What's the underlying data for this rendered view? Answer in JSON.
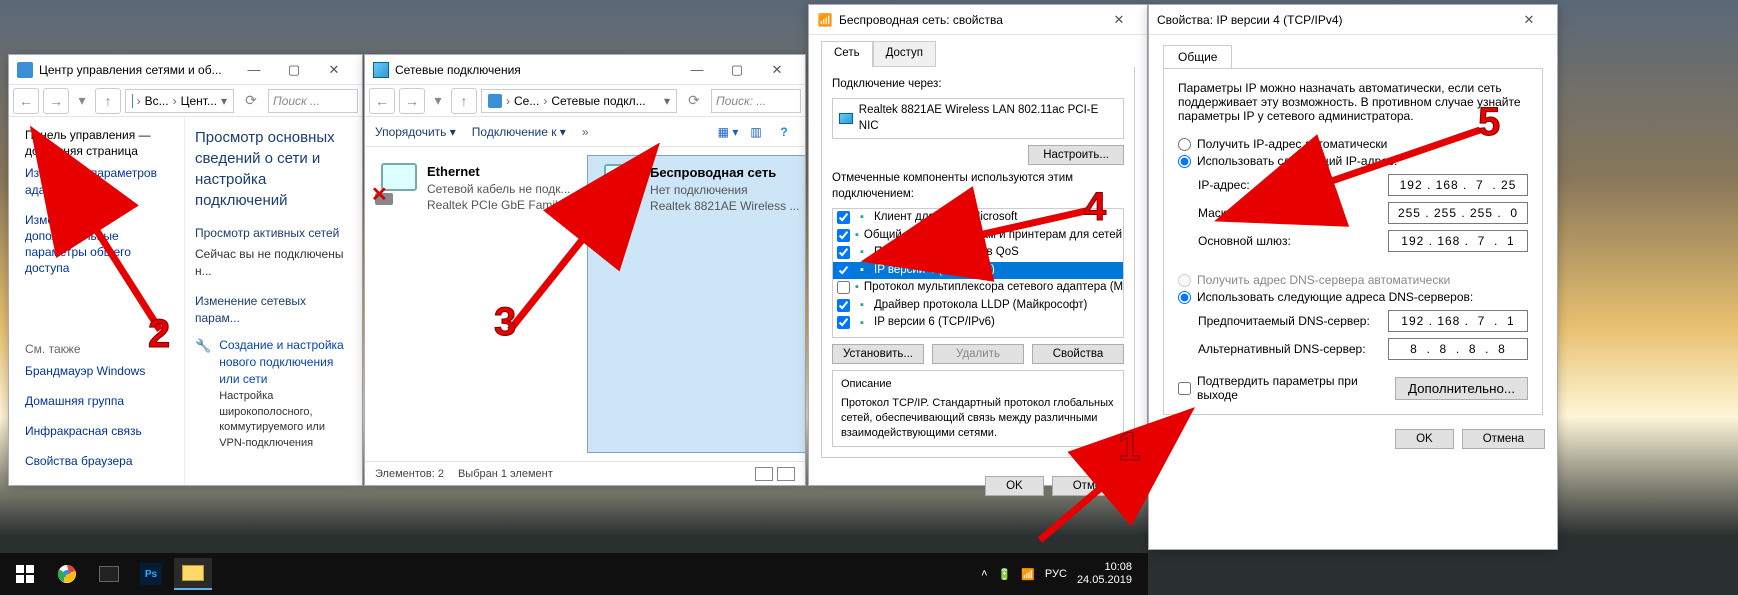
{
  "w1": {
    "title": "Центр управления сетями и об...",
    "crumb_a": "Вс...",
    "crumb_b": "Цент...",
    "search_ph": "Поиск ...",
    "left": {
      "home": "Панель управления — домашняя страница",
      "adapter": "Изменение параметров адаптера",
      "sharing": "Изменить дополнительные параметры общего доступа",
      "see_also": "См. также",
      "links": [
        "Брандмауэр Windows",
        "Домашняя группа",
        "Инфракрасная связь",
        "Свойства браузера"
      ]
    },
    "right": {
      "title": "Просмотр основных сведений о сети и настройка подключений",
      "sec1": "Просмотр активных сетей",
      "sec1_body": "Сейчас вы не подключены н...",
      "sec2": "Изменение сетевых парам...",
      "link1": "Создание и настройка нового подключения или сети",
      "link1_desc": "Настройка широкополосного, коммутируемого или VPN-подключения"
    }
  },
  "w2": {
    "title": "Сетевые подключения",
    "crumb_a": "Се...",
    "crumb_b": "Сетевые подкл...",
    "search_ph": "Поиск: ...",
    "tb_a": "Упорядочить",
    "tb_b": "Подключение к",
    "conn_eth": {
      "name": "Ethernet",
      "status": "Сетевой кабель не подк...",
      "dev": "Realtek PCIe GbE Family ..."
    },
    "conn_wifi": {
      "name": "Беспроводная сеть",
      "status": "Нет подключения",
      "dev": "Realtek 8821AE Wireless ..."
    },
    "status_count": "Элементов: 2",
    "status_sel": "Выбран 1 элемент"
  },
  "w3": {
    "title": "Беспроводная сеть: свойства",
    "tab_net": "Сеть",
    "tab_access": "Доступ",
    "conn_via": "Подключение через:",
    "adapter": "Realtek 8821AE Wireless LAN 802.11ac PCI-E NIC",
    "configure": "Настроить...",
    "components_label": "Отмеченные компоненты используются этим подключением:",
    "components": [
      {
        "checked": true,
        "label": "Клиент для сетей Microsoft"
      },
      {
        "checked": true,
        "label": "Общий доступ к файлам и принтерам для сетей Micr..."
      },
      {
        "checked": true,
        "label": "Планировщик пакетов QoS"
      },
      {
        "checked": true,
        "label": "IP версии 4 (TCP/IPv4)",
        "selected": true
      },
      {
        "checked": false,
        "label": "Протокол мультиплексора сетевого адаптера (Майкро..."
      },
      {
        "checked": true,
        "label": "Драйвер протокола LLDP (Майкрософт)"
      },
      {
        "checked": true,
        "label": "IP версии 6 (TCP/IPv6)"
      }
    ],
    "btn_install": "Установить...",
    "btn_remove": "Удалить",
    "btn_props": "Свойства",
    "desc_title": "Описание",
    "desc_body": "Протокол TCP/IP. Стандартный протокол глобальных сетей, обеспечивающий связь между различными взаимодействующими сетями.",
    "ok": "OK",
    "cancel": "Отмена"
  },
  "w4": {
    "title": "Свойства: IP версии 4 (TCP/IPv4)",
    "tab_general": "Общие",
    "intro": "Параметры IP можно назначать автоматически, если сеть поддерживает эту возможность. В противном случае узнайте параметры IP у сетевого администратора.",
    "r_ip_auto": "Получить IP-адрес автоматически",
    "r_ip_man": "Использовать следующий IP-адрес:",
    "lbl_ip": "IP-адрес:",
    "val_ip": "192 . 168 .  7  . 25",
    "lbl_mask": "Маска подсети:",
    "val_mask": "255 . 255 . 255 .  0",
    "lbl_gw": "Основной шлюз:",
    "val_gw": "192 . 168 .  7  .  1",
    "r_dns_auto": "Получить адрес DNS-сервера автоматически",
    "r_dns_man": "Использовать следующие адреса DNS-серверов:",
    "lbl_dns1": "Предпочитаемый DNS-сервер:",
    "val_dns1": "192 . 168 .  7  .  1",
    "lbl_dns2": "Альтернативный DNS-сервер:",
    "val_dns2": "8  .  8  .  8  .  8",
    "chk_validate": "Подтвердить параметры при выходе",
    "advanced": "Дополнительно...",
    "ok": "OK",
    "cancel": "Отмена"
  },
  "tb": {
    "lang": "РУС",
    "time": "10:08",
    "date": "24.05.2019"
  },
  "annot": {
    "n1": "1",
    "n2": "2",
    "n3": "3",
    "n4": "4",
    "n5": "5"
  }
}
